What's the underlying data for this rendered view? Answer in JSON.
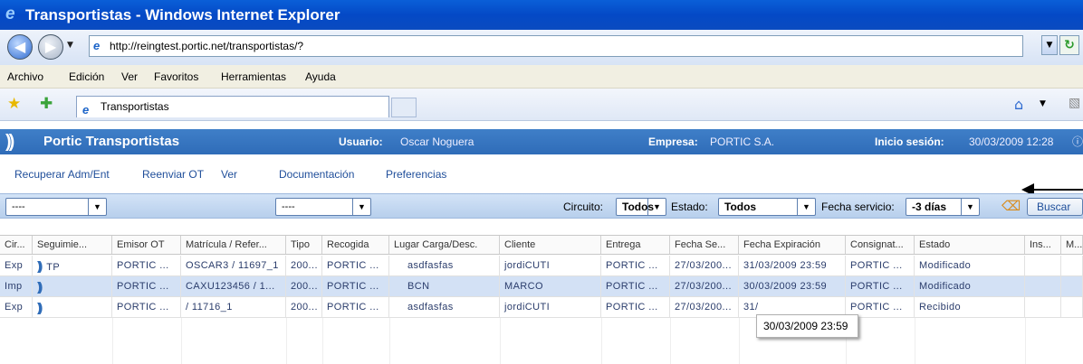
{
  "window": {
    "title": "Transportistas - Windows Internet Explorer"
  },
  "browser": {
    "url": "http://reingtest.portic.net/transportistas/?",
    "menu": [
      "Archivo",
      "Edición",
      "Ver",
      "Favoritos",
      "Herramientas",
      "Ayuda"
    ],
    "tab_title": "Transportistas"
  },
  "app": {
    "title": "Portic Transportistas",
    "user_label": "Usuario:",
    "user": "Oscar Noguera",
    "company_label": "Empresa:",
    "company": "PORTIC S.A.",
    "login_label": "Inicio sesión:",
    "login": "30/03/2009 12:28"
  },
  "toolbar": [
    "Recuperar Adm/Ent",
    "Reenviar OT",
    "Ver",
    "Documentación",
    "Preferencias"
  ],
  "filters": {
    "combo1": "----",
    "combo2": "----",
    "circuito_label": "Circuito:",
    "circuito": "Todos",
    "estado_label": "Estado:",
    "estado": "Todos",
    "fecha_label": "Fecha servicio:",
    "fecha": "-3 días",
    "search": "Buscar"
  },
  "grid": {
    "columns": [
      "Cir...",
      "Seguimie...",
      "Emisor OT",
      "Matrícula / Refer...",
      "Tipo",
      "Recogida",
      "Lugar Carga/Desc.",
      "Cliente",
      "Entrega",
      "Fecha Se...",
      "Fecha Expiración",
      "Consignat...",
      "Estado",
      "Ins...",
      "M..."
    ],
    "rows": [
      [
        "Exp",
        "TP",
        "PORTIC ...",
        "OSCAR3 / 11697_1",
        "200...",
        "PORTIC ...",
        "asdfasfas",
        "jordiCUTI",
        "PORTIC ...",
        "27/03/200...",
        "31/03/2009 23:59",
        "PORTIC ...",
        "Modificado",
        "",
        ""
      ],
      [
        "Imp",
        "",
        "PORTIC ...",
        "CAXU123456 / 1...",
        "200...",
        "PORTIC ...",
        "BCN",
        "MARCO",
        "PORTIC ...",
        "27/03/200...",
        "30/03/2009 23:59",
        "PORTIC ...",
        "Modificado",
        "",
        ""
      ],
      [
        "Exp",
        "",
        "PORTIC ...",
        "/ 11716_1",
        "200...",
        "PORTIC ...",
        "asdfasfas",
        "jordiCUTI",
        "PORTIC ...",
        "27/03/200...",
        "31/",
        "PORTIC ...",
        "Recibido",
        "",
        ""
      ]
    ],
    "tooltip": "30/03/2009 23:59"
  }
}
